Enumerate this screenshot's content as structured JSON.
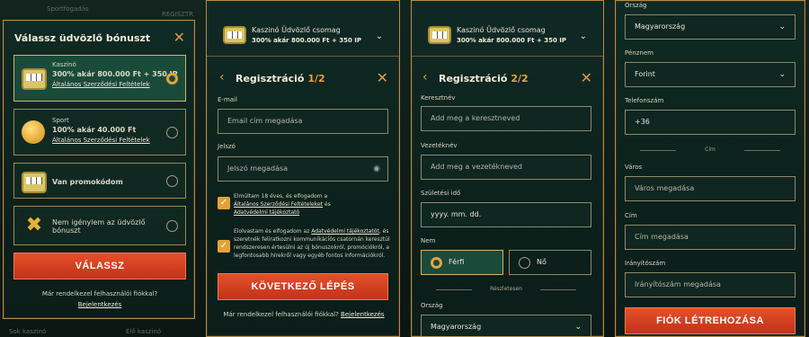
{
  "bg_texts": {
    "top_left": "Sportfogadás",
    "top_right": "REGISZTR",
    "bottom_left": "Sok kaszinó",
    "bottom_right": "Élő kaszinó"
  },
  "panel1": {
    "title": "Válassz üdvözlő bónuszt",
    "options": [
      {
        "kicker": "Kaszinó",
        "headline": "300% akár 800.000 Ft + 350 IP",
        "link": "Általános Szerződési Feltételek",
        "selected": true
      },
      {
        "kicker": "Sport",
        "headline": "100% akár 40.000 Ft",
        "link": "Általános Szerződési Feltételek",
        "selected": false
      },
      {
        "kicker": "",
        "headline": "Van promokódom",
        "link": "",
        "selected": false
      },
      {
        "kicker": "",
        "headline": "Nem igénylem az üdvözlő bónuszt",
        "link": "",
        "selected": false
      }
    ],
    "button": "VÁLASSZ",
    "login_q": "Már rendelkezel felhasználói fiókkal?",
    "login_link": "Bejelentkezés"
  },
  "bonus_head": {
    "title": "Kaszinó Üdvözlő csomag",
    "sub": "300% akár 800.000 Ft + 350 IP"
  },
  "panel2": {
    "title": "Regisztráció",
    "step": "1",
    "total": "/2",
    "email_label": "E-mail",
    "email_ph": "Email cím megadása",
    "pass_label": "Jelszó",
    "pass_ph": "Jelszó megadása",
    "chk1_a": "Elmúltam 18 éves, és elfogadom a",
    "chk1_b": "Általános Szerződési Feltételeket",
    "chk1_c": " és",
    "chk1_d": "Adatvédelmi tájékoztató",
    "chk2_a": "Elolvastam és elfogadom az ",
    "chk2_b": "Adatvédelmi tájékoztatót",
    "chk2_c": ", és szeretnék feliratkozni kommunikációs csatornán keresztül rendszeresen értesülni az új bónuszokról, promóciókról, a legfontosabb hírekről vagy egyéb fontos információkról.",
    "button": "KÖVETKEZŐ LÉPÉS",
    "login_q": "Már rendelkezel felhasználói fiókkal?",
    "login_link": "Bejelentkezés"
  },
  "panel3": {
    "title": "Regisztráció",
    "step": "2",
    "total": "/2",
    "first_label": "Keresztnév",
    "first_ph": "Add meg a keresztneved",
    "last_label": "Vezetéknév",
    "last_ph": "Add meg a vezetékneved",
    "dob_label": "Születési idő",
    "dob_ph": "yyyy. mm. dd.",
    "gender_label": "Nem",
    "male": "Férfi",
    "female": "Nő",
    "sep": "Részletesen",
    "country_label": "Ország",
    "country_val": "Magyarország"
  },
  "panel4": {
    "country_label": "Ország",
    "country_val": "Magyarország",
    "currency_label": "Pénznem",
    "currency_val": "Forint",
    "phone_label": "Telefonszám",
    "phone_val": "+36",
    "sep": "Cím",
    "city_label": "Város",
    "city_ph": "Város megadása",
    "addr_label": "Cím",
    "addr_ph": "Cím megadása",
    "zip_label": "Irányítószám",
    "zip_ph": "Irányítószám megadása",
    "button": "FIÓK LÉTREHOZÁSA"
  }
}
